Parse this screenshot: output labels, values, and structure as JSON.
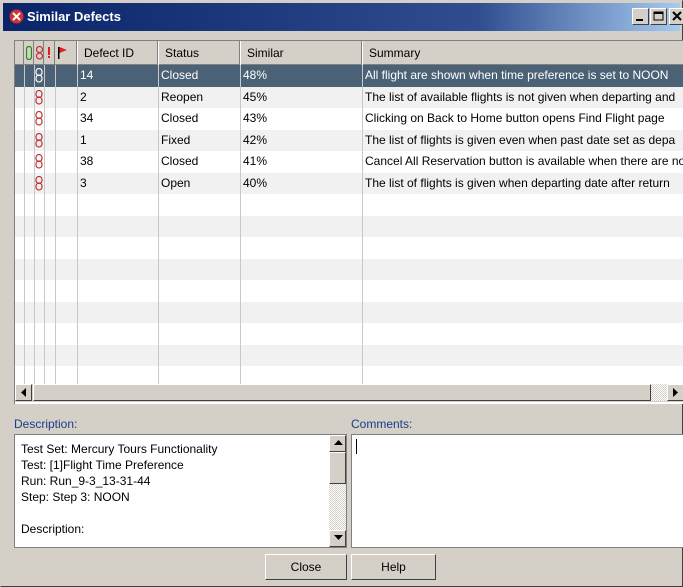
{
  "window": {
    "title": "Similar Defects",
    "buttons": {
      "minimize": "minimize",
      "maximize": "maximize",
      "close": "close"
    }
  },
  "grid": {
    "icon_headers": [
      "attachment-icon",
      "linked-icon",
      "priority-icon",
      "flag-icon"
    ],
    "columns": [
      "Defect ID",
      "Status",
      "Similar",
      "Summary"
    ],
    "rows": [
      {
        "id": "14",
        "status": "Closed",
        "similar": "48%",
        "summary": "All flight are shown when time preference is set to NOON",
        "selected": true
      },
      {
        "id": "2",
        "status": "Reopen",
        "similar": "45%",
        "summary": "The list of available flights is not given when departing and",
        "selected": false
      },
      {
        "id": "34",
        "status": "Closed",
        "similar": "43%",
        "summary": "Clicking on Back to Home button opens Find Flight page",
        "selected": false
      },
      {
        "id": "1",
        "status": "Fixed",
        "similar": "42%",
        "summary": "The list of flights is given even when past date set as depa",
        "selected": false
      },
      {
        "id": "38",
        "status": "Closed",
        "similar": "41%",
        "summary": "Cancel All Reservation button is available when there are no",
        "selected": false
      },
      {
        "id": "3",
        "status": "Open",
        "similar": "40%",
        "summary": "The list of flights is given when departing date after return",
        "selected": false
      }
    ],
    "empty_rows": 8
  },
  "description": {
    "label": "Description:",
    "text": "Test Set: Mercury Tours Functionality\nTest: [1]Flight Time Preference\nRun: Run_9-3_13-31-44\nStep: Step 3: NOON\n\nDescription:"
  },
  "comments": {
    "label": "Comments:",
    "value": ""
  },
  "footer": {
    "close_label": "Close",
    "help_label": "Help"
  },
  "colors": {
    "selection": "#4a6176",
    "title_start": "#0a246a",
    "title_end": "#a6caf0",
    "label": "#1a3c8a"
  }
}
